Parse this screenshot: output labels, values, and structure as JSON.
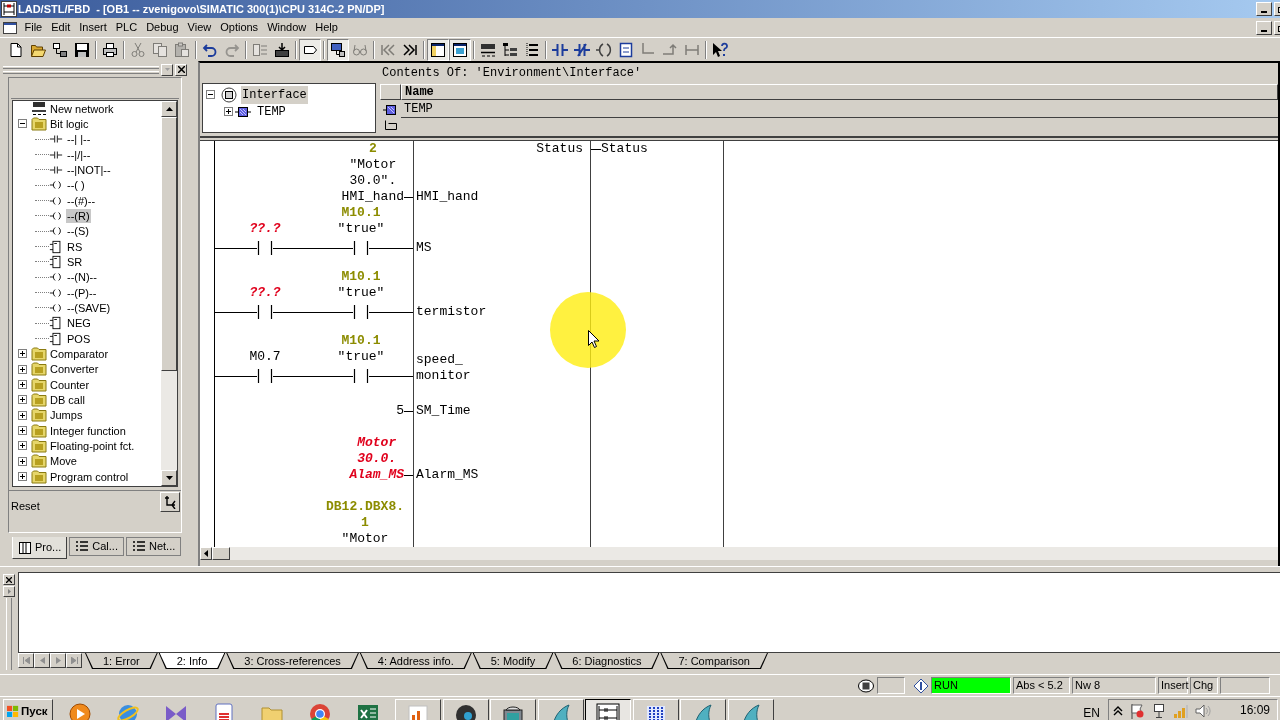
{
  "window": {
    "title": "LAD/STL/FBD  - [OB1 -- zvenigovo\\SIMATIC 300(1)\\CPU 314C-2 PN/DP]"
  },
  "menu": [
    "File",
    "Edit",
    "Insert",
    "PLC",
    "Debug",
    "View",
    "Options",
    "Window",
    "Help"
  ],
  "toolbar": [
    [
      {
        "kind": "new",
        "disabled": false,
        "pressed": false
      },
      {
        "kind": "open",
        "disabled": false,
        "pressed": false
      },
      {
        "kind": "nodes",
        "disabled": false,
        "pressed": false
      },
      {
        "kind": "save",
        "disabled": false,
        "pressed": false
      }
    ],
    [
      {
        "kind": "print",
        "disabled": false,
        "pressed": false
      }
    ],
    [
      {
        "kind": "cut",
        "disabled": true,
        "pressed": false
      },
      {
        "kind": "copy",
        "disabled": true,
        "pressed": false
      },
      {
        "kind": "paste",
        "disabled": true,
        "pressed": false
      }
    ],
    [
      {
        "kind": "undo",
        "disabled": false,
        "pressed": false
      },
      {
        "kind": "redo",
        "disabled": true,
        "pressed": false
      }
    ],
    [
      {
        "kind": "compile",
        "disabled": true,
        "pressed": false
      },
      {
        "kind": "download",
        "disabled": false,
        "pressed": false
      }
    ],
    [
      {
        "kind": "overview",
        "disabled": false,
        "pressed": true
      }
    ],
    [
      {
        "kind": "connect",
        "disabled": false,
        "pressed": true
      },
      {
        "kind": "glasses",
        "disabled": true,
        "pressed": false
      }
    ],
    [
      {
        "kind": "first",
        "disabled": true,
        "pressed": false
      },
      {
        "kind": "last",
        "disabled": false,
        "pressed": false
      }
    ],
    [
      {
        "kind": "panel",
        "disabled": false,
        "pressed": true
      },
      {
        "kind": "zoom",
        "disabled": false,
        "pressed": true
      }
    ],
    [
      {
        "kind": "new-network",
        "disabled": false,
        "pressed": false
      },
      {
        "kind": "tree",
        "disabled": false,
        "pressed": false
      },
      {
        "kind": "list",
        "disabled": false,
        "pressed": false
      }
    ],
    [
      {
        "kind": "contact-no",
        "disabled": false,
        "pressed": false
      },
      {
        "kind": "contact-nc",
        "disabled": false,
        "pressed": false
      },
      {
        "kind": "coil",
        "disabled": false,
        "pressed": false
      },
      {
        "kind": "box",
        "disabled": false,
        "pressed": false
      },
      {
        "kind": "branch-open",
        "disabled": true,
        "pressed": false
      },
      {
        "kind": "branch-close",
        "disabled": true,
        "pressed": false
      },
      {
        "kind": "connection",
        "disabled": true,
        "pressed": false
      }
    ],
    [
      {
        "kind": "help",
        "disabled": false,
        "pressed": false
      }
    ]
  ],
  "palette": {
    "items": [
      {
        "label": "New network",
        "kind": "network",
        "selected": false
      },
      {
        "label": "Bit logic",
        "kind": "folder",
        "expanded": true,
        "selected": false,
        "children": [
          {
            "label": "--| |--",
            "kind": "contact",
            "selected": false
          },
          {
            "label": "--|/|--",
            "kind": "contact",
            "selected": false
          },
          {
            "label": "--|NOT|--",
            "kind": "contact",
            "selected": false
          },
          {
            "label": "--( )",
            "kind": "coil",
            "selected": false
          },
          {
            "label": "--(#)--",
            "kind": "coil",
            "selected": false
          },
          {
            "label": "--(R)",
            "kind": "coil",
            "selected": true
          },
          {
            "label": "--(S)",
            "kind": "coil",
            "selected": false
          },
          {
            "label": "RS",
            "kind": "box",
            "selected": false
          },
          {
            "label": "SR",
            "kind": "box",
            "selected": false
          },
          {
            "label": "--(N)--",
            "kind": "coil",
            "selected": false
          },
          {
            "label": "--(P)--",
            "kind": "coil",
            "selected": false
          },
          {
            "label": "--(SAVE)",
            "kind": "coil",
            "selected": false
          },
          {
            "label": "NEG",
            "kind": "box",
            "selected": false
          },
          {
            "label": "POS",
            "kind": "box",
            "selected": false
          }
        ]
      },
      {
        "label": "Comparator",
        "kind": "folder",
        "expanded": false,
        "selected": false
      },
      {
        "label": "Converter",
        "kind": "folder",
        "expanded": false,
        "selected": false
      },
      {
        "label": "Counter",
        "kind": "folder",
        "expanded": false,
        "selected": false
      },
      {
        "label": "DB call",
        "kind": "folder",
        "expanded": false,
        "selected": false
      },
      {
        "label": "Jumps",
        "kind": "folder",
        "expanded": false,
        "selected": false
      },
      {
        "label": "Integer function",
        "kind": "folder",
        "expanded": false,
        "selected": false
      },
      {
        "label": "Floating-point fct.",
        "kind": "folder",
        "expanded": false,
        "selected": false
      },
      {
        "label": "Move",
        "kind": "folder",
        "expanded": false,
        "selected": false
      },
      {
        "label": "Program control",
        "kind": "folder",
        "expanded": false,
        "selected": false
      }
    ],
    "description": "Reset",
    "tabs": [
      {
        "label": "Pro...",
        "kind": "book",
        "selected": true
      },
      {
        "label": "Cal...",
        "kind": "list",
        "selected": false
      },
      {
        "label": "Net...",
        "kind": "list",
        "selected": false
      }
    ]
  },
  "interface": {
    "tree": [
      {
        "label": "Interface",
        "expanded": true,
        "selected": true,
        "children": [
          {
            "label": "TEMP",
            "expanded": false,
            "selected": false
          }
        ]
      }
    ],
    "contents_title": "Contents Of: 'Environment\\Interface'",
    "columns": [
      "Name"
    ],
    "rows": [
      {
        "cells": [
          "TEMP"
        ]
      }
    ]
  },
  "ladder": {
    "rows": [
      {
        "kind": "pin",
        "operand": [
          {
            "kind": "address",
            "lines": [
              "2"
            ]
          },
          {
            "kind": "plain",
            "lines": [
              "\"Motor",
              "30.0\".",
              "HMI_hand"
            ]
          }
        ],
        "pin": [
          "HMI_hand"
        ],
        "output_pin": "Status",
        "output_operand": "Status"
      },
      {
        "kind": "rung",
        "contacts": [
          {
            "operand": [
              {
                "kind": "invalid",
                "lines": [
                  "??.?"
                ]
              }
            ]
          },
          {
            "operand": [
              {
                "kind": "address",
                "lines": [
                  "M10.1"
                ]
              },
              {
                "kind": "plain",
                "lines": [
                  "\"true\""
                ]
              }
            ]
          }
        ],
        "pin": [
          "MS"
        ]
      },
      {
        "kind": "rung",
        "contacts": [
          {
            "operand": [
              {
                "kind": "invalid",
                "lines": [
                  "??.?"
                ]
              }
            ]
          },
          {
            "operand": [
              {
                "kind": "address",
                "lines": [
                  "M10.1"
                ]
              },
              {
                "kind": "plain",
                "lines": [
                  "\"true\""
                ]
              }
            ]
          }
        ],
        "pin": [
          "termistor"
        ]
      },
      {
        "kind": "rung",
        "contacts": [
          {
            "operand": [
              {
                "kind": "plain",
                "lines": [
                  "M0.7"
                ]
              }
            ]
          },
          {
            "operand": [
              {
                "kind": "address",
                "lines": [
                  "M10.1"
                ]
              },
              {
                "kind": "plain",
                "lines": [
                  "\"true\""
                ]
              }
            ]
          }
        ],
        "pin": [
          "speed_",
          "monitor"
        ]
      },
      {
        "kind": "pin",
        "operand": [
          {
            "kind": "plain",
            "lines": [
              "5"
            ]
          }
        ],
        "pin": [
          "SM_Time"
        ]
      },
      {
        "kind": "pin",
        "operand": [
          {
            "kind": "invalid",
            "lines": [
              "Motor",
              "30.0.",
              "Alam_MS"
            ]
          }
        ],
        "pin": [
          "Alarm_MS"
        ]
      },
      {
        "kind": "pin",
        "operand": [
          {
            "kind": "address",
            "lines": [
              "DB12.DBX8.",
              "1"
            ]
          },
          {
            "kind": "plain",
            "lines": [
              "\"Motor"
            ]
          }
        ]
      }
    ]
  },
  "output": {
    "tabs": [
      {
        "label": "1: Error",
        "selected": false
      },
      {
        "label": "2: Info",
        "selected": true
      },
      {
        "label": "3: Cross-references",
        "selected": false
      },
      {
        "label": "4: Address info.",
        "selected": false
      },
      {
        "label": "5: Modify",
        "selected": false
      },
      {
        "label": "6: Diagnostics",
        "selected": false
      },
      {
        "label": "7: Comparison",
        "selected": false
      }
    ]
  },
  "status_bar": {
    "mode": {
      "text": "RUN",
      "running": true
    },
    "address": "Abs < 5.2",
    "network": "Nw 8",
    "edit_mode": "Insert",
    "change": "Chg"
  },
  "taskbar": {
    "start": "Пуск",
    "quick_launch": [
      {
        "kind": "play"
      },
      {
        "kind": "globe"
      },
      {
        "kind": "ribbon"
      },
      {
        "kind": "document"
      },
      {
        "kind": "folder"
      },
      {
        "kind": "wheel"
      },
      {
        "kind": "sheet"
      }
    ],
    "tasks": [
      {
        "kind": "chart",
        "selected": false
      },
      {
        "kind": "disc",
        "selected": false
      },
      {
        "kind": "module",
        "selected": false
      },
      {
        "kind": "fin",
        "selected": false
      },
      {
        "kind": "ladder",
        "selected": true
      },
      {
        "kind": "bars",
        "selected": false
      },
      {
        "kind": "fin",
        "selected": false
      },
      {
        "kind": "fin",
        "selected": false
      }
    ],
    "language": "EN",
    "clock": "16:09"
  }
}
